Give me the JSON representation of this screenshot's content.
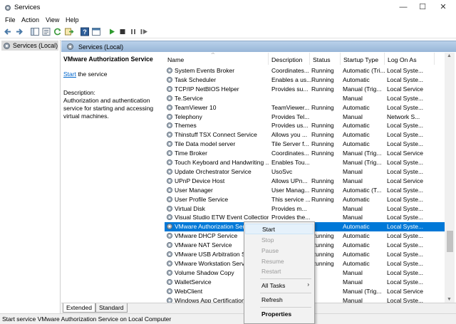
{
  "window": {
    "title": "Services"
  },
  "menu": [
    "File",
    "Action",
    "View",
    "Help"
  ],
  "tree": {
    "label": "Services (Local)"
  },
  "panel": {
    "header": "Services (Local)",
    "selected_service": "VMware Authorization Service",
    "start_link": "Start",
    "start_suffix": " the service",
    "description_label": "Description:",
    "description_text": "Authorization and authentication service for starting and accessing virtual machines."
  },
  "columns": [
    "Name",
    "Description",
    "Status",
    "Startup Type",
    "Log On As"
  ],
  "services": [
    {
      "name": "System Events Broker",
      "desc": "Coordinates...",
      "status": "Running",
      "type": "Automatic (Tri...",
      "logon": "Local Syste..."
    },
    {
      "name": "Task Scheduler",
      "desc": "Enables a us...",
      "status": "Running",
      "type": "Automatic",
      "logon": "Local Syste..."
    },
    {
      "name": "TCP/IP NetBIOS Helper",
      "desc": "Provides su...",
      "status": "Running",
      "type": "Manual (Trig...",
      "logon": "Local Service"
    },
    {
      "name": "Te.Service",
      "desc": "",
      "status": "",
      "type": "Manual",
      "logon": "Local Syste..."
    },
    {
      "name": "TeamViewer 10",
      "desc": "TeamViewer...",
      "status": "Running",
      "type": "Automatic",
      "logon": "Local Syste..."
    },
    {
      "name": "Telephony",
      "desc": "Provides Tel...",
      "status": "",
      "type": "Manual",
      "logon": "Network S..."
    },
    {
      "name": "Themes",
      "desc": "Provides us...",
      "status": "Running",
      "type": "Automatic",
      "logon": "Local Syste..."
    },
    {
      "name": "Thinstuff TSX Connect Service",
      "desc": "Allows you ...",
      "status": "Running",
      "type": "Automatic",
      "logon": "Local Syste..."
    },
    {
      "name": "Tile Data model server",
      "desc": "Tile Server f...",
      "status": "Running",
      "type": "Automatic",
      "logon": "Local Syste..."
    },
    {
      "name": "Time Broker",
      "desc": "Coordinates...",
      "status": "Running",
      "type": "Manual (Trig...",
      "logon": "Local Service"
    },
    {
      "name": "Touch Keyboard and Handwriting ...",
      "desc": "Enables Tou...",
      "status": "",
      "type": "Manual (Trig...",
      "logon": "Local Syste..."
    },
    {
      "name": "Update Orchestrator Service",
      "desc": "UsoSvc",
      "status": "",
      "type": "Manual",
      "logon": "Local Syste..."
    },
    {
      "name": "UPnP Device Host",
      "desc": "Allows UPn...",
      "status": "Running",
      "type": "Manual",
      "logon": "Local Service"
    },
    {
      "name": "User Manager",
      "desc": "User Manag...",
      "status": "Running",
      "type": "Automatic (T...",
      "logon": "Local Syste..."
    },
    {
      "name": "User Profile Service",
      "desc": "This service ...",
      "status": "Running",
      "type": "Automatic",
      "logon": "Local Syste..."
    },
    {
      "name": "Virtual Disk",
      "desc": "Provides m...",
      "status": "",
      "type": "Manual",
      "logon": "Local Syste..."
    },
    {
      "name": "Visual Studio ETW Event Collection...",
      "desc": "Provides the...",
      "status": "",
      "type": "Manual",
      "logon": "Local Syste..."
    },
    {
      "name": "VMware Authorization Servi...",
      "desc": "",
      "status": "",
      "type": "Automatic",
      "logon": "Local Syste...",
      "selected": true
    },
    {
      "name": "VMware DHCP Service",
      "desc": "",
      "status": "Running",
      "type": "Automatic",
      "logon": "Local Syste..."
    },
    {
      "name": "VMware NAT Service",
      "desc": "",
      "status": "Running",
      "type": "Automatic",
      "logon": "Local Syste..."
    },
    {
      "name": "VMware USB Arbitration Ser...",
      "desc": "",
      "status": "Running",
      "type": "Automatic",
      "logon": "Local Syste..."
    },
    {
      "name": "VMware Workstation Server",
      "desc": "",
      "status": "Running",
      "type": "Automatic",
      "logon": "Local Syste..."
    },
    {
      "name": "Volume Shadow Copy",
      "desc": "",
      "status": "",
      "type": "Manual",
      "logon": "Local Syste..."
    },
    {
      "name": "WalletService",
      "desc": "",
      "status": "",
      "type": "Manual",
      "logon": "Local Syste..."
    },
    {
      "name": "WebClient",
      "desc": "",
      "status": "",
      "type": "Manual (Trig...",
      "logon": "Local Service"
    },
    {
      "name": "Windows App Certification ...",
      "desc": "",
      "status": "",
      "type": "Manual",
      "logon": "Local Syste..."
    }
  ],
  "context_menu": {
    "start": "Start",
    "stop": "Stop",
    "pause": "Pause",
    "resume": "Resume",
    "restart": "Restart",
    "all_tasks": "All Tasks",
    "refresh": "Refresh",
    "properties": "Properties"
  },
  "tabs": [
    "Extended",
    "Standard"
  ],
  "status_bar": "Start service VMware Authorization Service on Local Computer",
  "colors": {
    "selection": "#0078d7",
    "header_gradient": "#b9d1ea",
    "link": "#0066cc"
  }
}
